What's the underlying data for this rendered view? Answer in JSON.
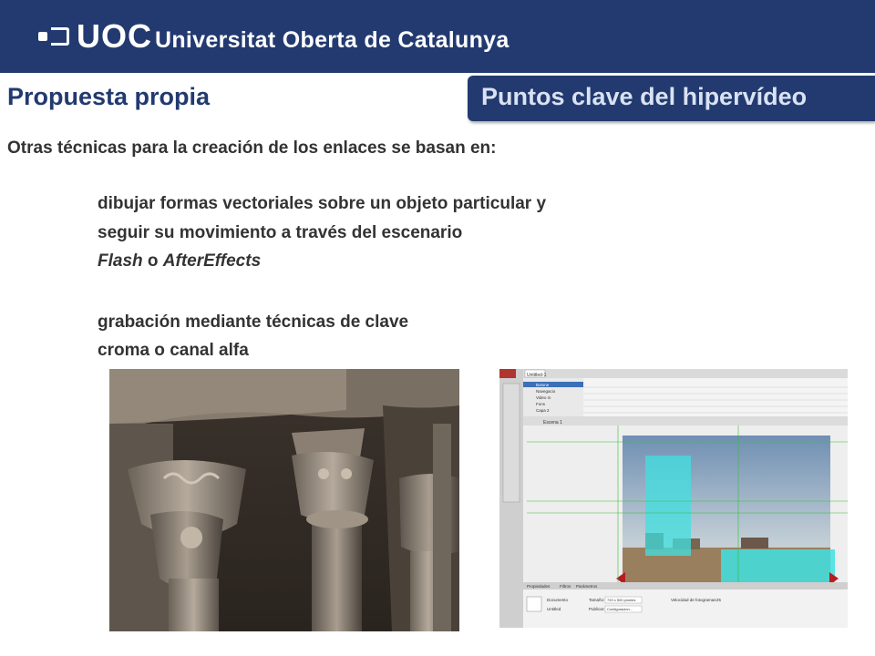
{
  "header": {
    "logo_abbr": "UOC",
    "logo_name": "Universitat Oberta de Catalunya"
  },
  "slide": {
    "title": "Propuesta propia",
    "tab": "Puntos clave del hipervídeo"
  },
  "content": {
    "intro": "Otras técnicas para la creación de los enlaces se basan en:",
    "line1": "dibujar formas vectoriales sobre un objeto particular y",
    "line2": "seguir su movimiento a través del escenario",
    "line3_a": "Flash",
    "line3_b": " o ",
    "line3_c": "AfterEffects",
    "line4": "grabación mediante técnicas de clave",
    "line5": "croma o canal alfa"
  },
  "images": {
    "left": "photo of romanesque cloister capitals",
    "right": "screenshot of Flash authoring environment"
  },
  "flash_ui": {
    "tab_label": "Untitled-1",
    "layers": [
      "Botone",
      "Navegacio",
      "Video m",
      "Fons",
      "Capa 2"
    ],
    "scene_label": "Escena 1",
    "panel_tabs": [
      "Propiedades",
      "Filtros",
      "Parámetros"
    ],
    "doc_type": "Documento",
    "doc_name": "Untitled",
    "size_label": "Tamaño:",
    "size_value": "720 x 500 píxeles",
    "publish_label": "Publicar:",
    "publish_value": "Configuración...",
    "fps_label": "Velocidad de fotogramas:",
    "fps_value": "25"
  },
  "colors": {
    "brand": "#223a70",
    "text": "#333333",
    "tab_text": "#d9e2f2",
    "hotspot": "#40e0e0"
  }
}
